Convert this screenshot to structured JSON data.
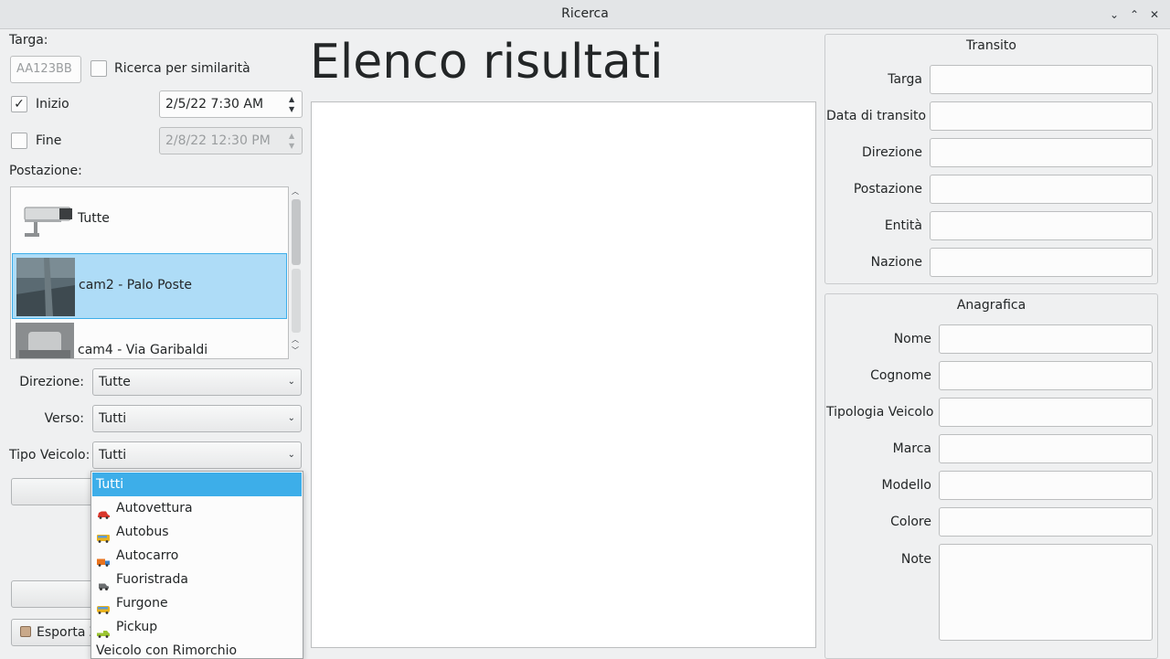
{
  "window": {
    "title": "Ricerca",
    "controls": {
      "minimize": "⌄",
      "maximize": "⌃",
      "close": "✕"
    }
  },
  "search": {
    "plate_label": "Targa:",
    "plate_placeholder": "AA123BB",
    "similarity_label": "Ricerca per similarità",
    "similarity_checked": false,
    "start_label": "Inizio",
    "start_checked": true,
    "start_value": "2/5/22 7:30 AM",
    "end_label": "Fine",
    "end_checked": false,
    "end_value": "2/8/22 12:30 PM",
    "location_label": "Postazione:",
    "locations": [
      {
        "label": "Tutte",
        "icon": "camera-icon"
      },
      {
        "label": "cam2 - Palo Poste",
        "icon": "camera-thumbnail-icon",
        "selected": true
      },
      {
        "label": "cam4 - Via Garibaldi",
        "icon": "camera-thumbnail-icon"
      }
    ],
    "direction_label": "Direzione:",
    "direction_value": "Tutte",
    "verse_label": "Verso:",
    "verse_value": "Tutti",
    "vehicle_type_label": "Tipo Veicolo:",
    "vehicle_type_value": "Tutti",
    "export_label": "Esporta Z"
  },
  "vehicle_type_options": [
    {
      "label": "Tutti",
      "icon": "",
      "selected": true
    },
    {
      "label": "Autovettura",
      "icon": "car-icon",
      "color": "#d9362b"
    },
    {
      "label": "Autobus",
      "icon": "bus-icon",
      "color": "#e8b21e"
    },
    {
      "label": "Autocarro",
      "icon": "truck-icon",
      "color": "#e8731e"
    },
    {
      "label": "Fuoristrada",
      "icon": "offroad-icon",
      "color": "#6b6e70"
    },
    {
      "label": "Furgone",
      "icon": "van-icon",
      "color": "#e8b21e"
    },
    {
      "label": "Pickup",
      "icon": "pickup-icon",
      "color": "#9bc431"
    },
    {
      "label": "Veicolo con Rimorchio",
      "icon": ""
    }
  ],
  "results": {
    "title": "Elenco risultati"
  },
  "transit": {
    "title": "Transito",
    "fields": [
      {
        "label": "Targa",
        "value": ""
      },
      {
        "label": "Data di transito",
        "value": ""
      },
      {
        "label": "Direzione",
        "value": ""
      },
      {
        "label": "Postazione",
        "value": ""
      },
      {
        "label": "Entità",
        "value": ""
      },
      {
        "label": "Nazione",
        "value": ""
      }
    ]
  },
  "registry": {
    "title": "Anagrafica",
    "fields": [
      {
        "label": "Nome",
        "value": ""
      },
      {
        "label": "Cognome",
        "value": ""
      },
      {
        "label": "Tipologia Veicolo",
        "value": ""
      },
      {
        "label": "Marca",
        "value": ""
      },
      {
        "label": "Modello",
        "value": ""
      },
      {
        "label": "Colore",
        "value": ""
      },
      {
        "label": "Note",
        "value": ""
      }
    ]
  }
}
